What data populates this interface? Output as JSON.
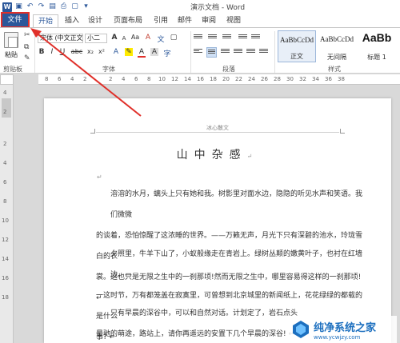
{
  "window": {
    "title": "演示文档 - Word"
  },
  "quick_access": {
    "app_logo": "W",
    "icons": [
      "save-icon",
      "undo-icon",
      "redo-icon",
      "open-icon",
      "print-icon",
      "new-doc-icon",
      "more-icon"
    ]
  },
  "tabs": {
    "file": "文件",
    "items": [
      "开始",
      "插入",
      "设计",
      "页面布局",
      "引用",
      "邮件",
      "审阅",
      "视图"
    ]
  },
  "ribbon": {
    "clipboard": {
      "paste": "粘贴",
      "group": "剪贴板"
    },
    "font": {
      "name": "宋体 (中文正文)",
      "size": "小二",
      "group": "字体",
      "bold": "B",
      "italic": "I",
      "underline": "U",
      "strike": "abc",
      "sub": "x₂",
      "sup": "x²",
      "color_a": "A",
      "grow": "A",
      "shrink": "A",
      "aa": "Aa",
      "clear": "A"
    },
    "paragraph": {
      "group": "段落"
    },
    "styles": {
      "group": "样式",
      "items": [
        {
          "preview": "AaBbCcDd",
          "name": "正文"
        },
        {
          "preview": "AaBbCcDd",
          "name": "无间隔"
        },
        {
          "preview": "AaBb",
          "name": "标题 1"
        }
      ]
    }
  },
  "ruler": {
    "h_numbers": [
      "8",
      "6",
      "4",
      "2",
      "",
      "2",
      "4",
      "6",
      "8",
      "10",
      "12",
      "14",
      "16",
      "18",
      "20",
      "22",
      "24",
      "26",
      "28",
      "30",
      "32",
      "34",
      "36",
      "38"
    ],
    "v_numbers": [
      "4",
      "2",
      "",
      "2",
      "4",
      "6",
      "8",
      "10",
      "12",
      "14",
      "16",
      "18"
    ]
  },
  "document": {
    "header": "冰心散文",
    "title": "山中杂感",
    "paramark": "↵",
    "paragraphs": [
      [
        "溶溶的水月，螭头上只有她和我。树影里对面水边，隐隐的听见水声和笑语。我们微微",
        "的谈着，恐怕惊醒了这浓睡的世界。——万籁无声，月光下只有深碧的池水，玲珑雪白的衣",
        "裳。这也只是无限之生中的一刹那顷!然而无限之生中，哪里容易得这样的一刹那顷! ↵"
      ],
      [
        "夕照里，牛羊下山了，小蚁般缘走在青岩上。绿树丛颠的嫩黄叶子，也衬在红墙边。—",
        "一这时节，万有都笼盖在寂寞里，可曾想到北京城里的新闻纸上，花花绿绿的都载的是什么",
        "事? ↵"
      ],
      [
        "只有早晨的深谷中，可以和自然对话。计划定了，岩石点头",
        "晕驰的萌途，路站上，请你再遥远的安置下几个早晨的深谷! ↵"
      ]
    ]
  },
  "watermark": {
    "title": "纯净系统之家",
    "url": "www.ycwjzy.com"
  }
}
